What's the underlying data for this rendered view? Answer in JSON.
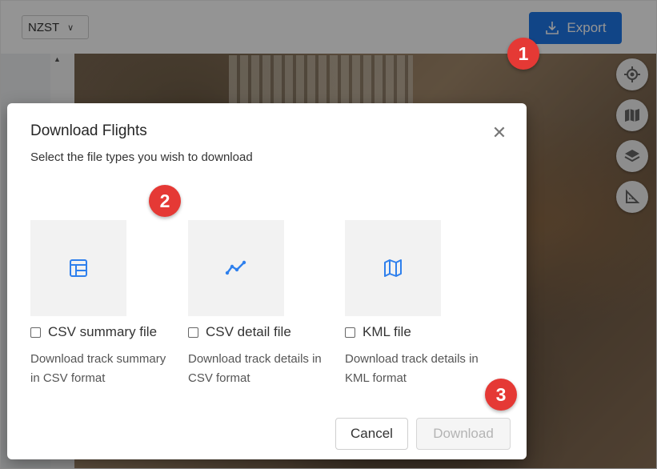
{
  "header": {
    "timezone": "NZST",
    "export_label": "Export"
  },
  "map_tools": [
    {
      "icon": "locate-icon"
    },
    {
      "icon": "map-icon"
    },
    {
      "icon": "layers-icon"
    },
    {
      "icon": "ruler-icon"
    }
  ],
  "modal": {
    "title": "Download Flights",
    "subtitle": "Select the file types you wish to download",
    "options": [
      {
        "icon": "table-icon",
        "label": "CSV summary file",
        "description": "Download track summary in CSV format",
        "checked": false
      },
      {
        "icon": "line-chart-icon",
        "label": "CSV detail file",
        "description": "Download track details in CSV format",
        "checked": false
      },
      {
        "icon": "map-icon",
        "label": "KML file",
        "description": "Download track details in KML format",
        "checked": false
      }
    ],
    "cancel_label": "Cancel",
    "download_label": "Download"
  },
  "callouts": [
    "1",
    "2",
    "3"
  ],
  "colors": {
    "accent": "#1e77e8",
    "callout": "#e53935",
    "icon_blue": "#2f80ed"
  }
}
